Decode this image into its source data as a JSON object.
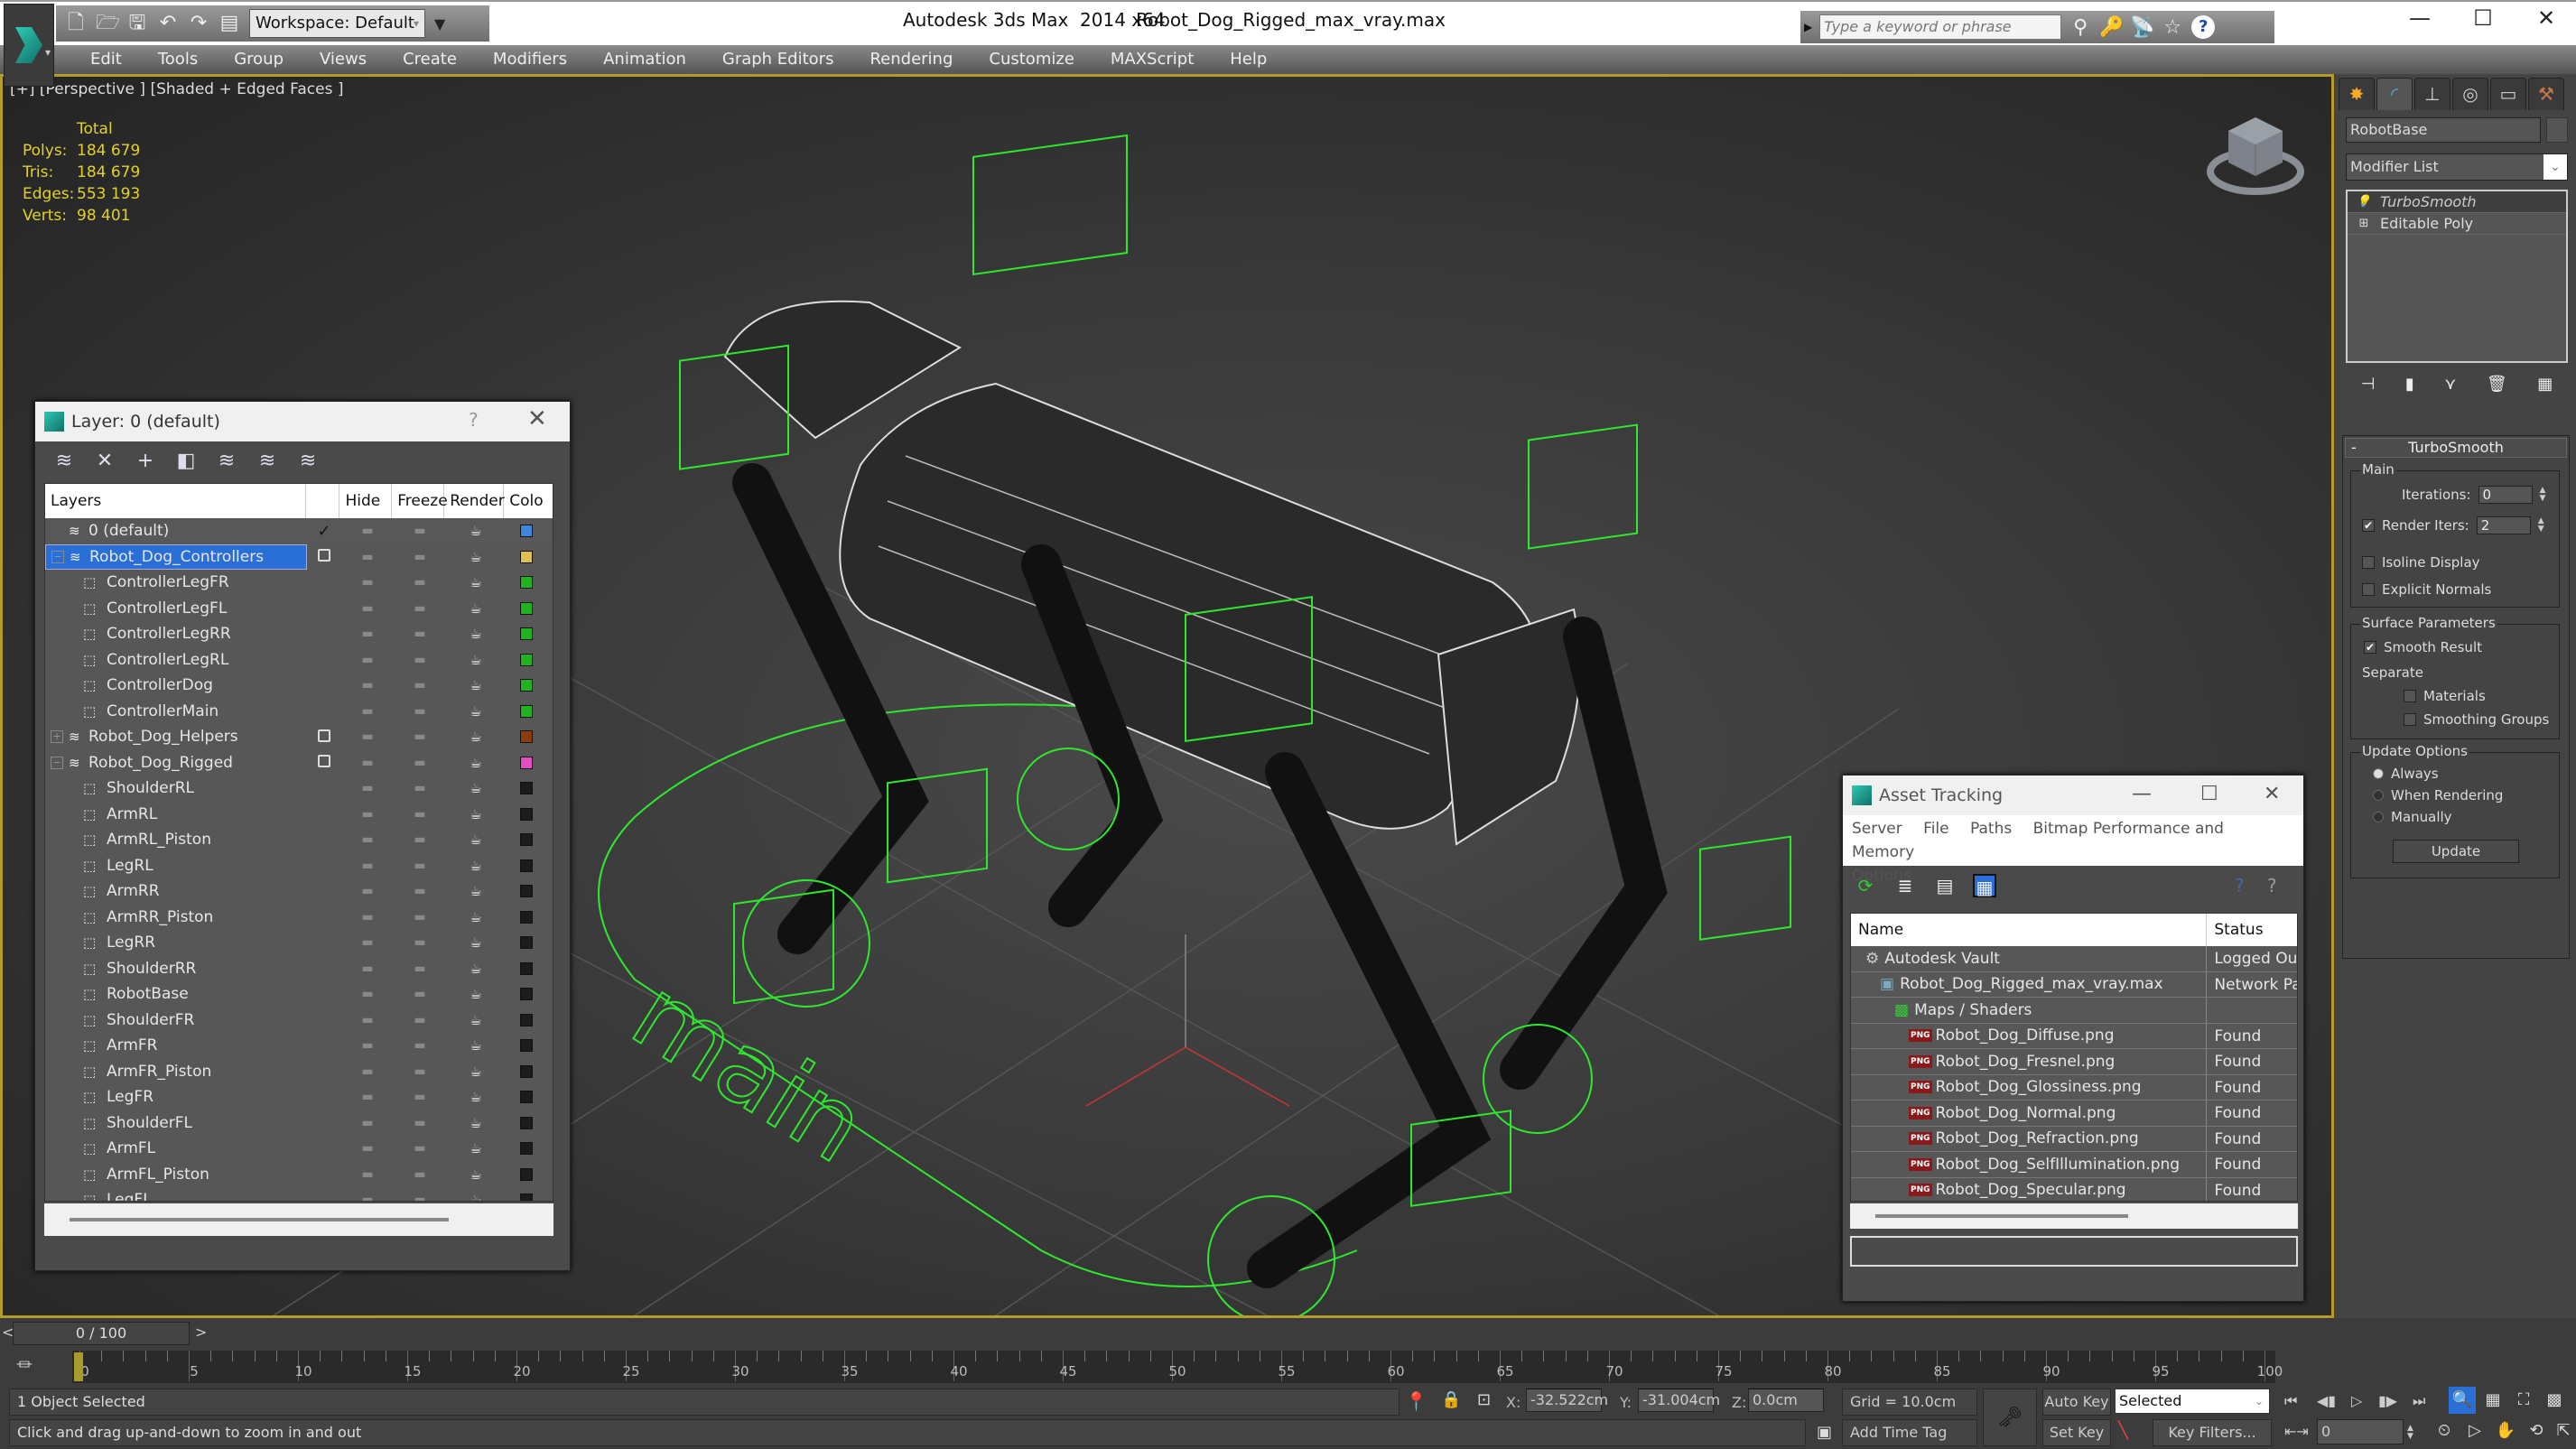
{
  "window": {
    "app_title": "Autodesk 3ds Max  2014 x64",
    "file_title": "Robot_Dog_Rigged_max_vray.max",
    "workspace": "Workspace: Default",
    "search_placeholder": "Type a keyword or phrase",
    "controls": {
      "minimize": "—",
      "maximize": "☐",
      "close": "✕"
    }
  },
  "menu": [
    "Edit",
    "Tools",
    "Group",
    "Views",
    "Create",
    "Modifiers",
    "Animation",
    "Graph Editors",
    "Rendering",
    "Customize",
    "MAXScript",
    "Help"
  ],
  "viewport": {
    "label": "[+] [Perspective ] [Shaded + Edged Faces ]",
    "stats": {
      "header": "Total",
      "rows": [
        {
          "key": "Polys:",
          "value": "184 679"
        },
        {
          "key": "Tris:",
          "value": "184 679"
        },
        {
          "key": "Edges:",
          "value": "553 193"
        },
        {
          "key": "Verts:",
          "value": "98 401"
        }
      ]
    },
    "ground_text": "main",
    "accent_color": "#b59a2c",
    "wire_color": "#2ee82e"
  },
  "layer_dialog": {
    "title": "Layer: 0 (default)",
    "help": "?",
    "close": "✕",
    "columns": [
      "Layers",
      "",
      "Hide",
      "Freeze",
      "Render",
      "Colo"
    ],
    "rows": [
      {
        "name": "0 (default)",
        "type": "layer",
        "expand": "",
        "current": "check",
        "color": "#3f86e0"
      },
      {
        "name": "Robot_Dog_Controllers",
        "type": "layer",
        "expand": "−",
        "current": "box",
        "color": "#e0c050",
        "selected": true
      },
      {
        "name": "ControllerLegFR",
        "type": "object",
        "color": "#1fb41f"
      },
      {
        "name": "ControllerLegFL",
        "type": "object",
        "color": "#1fb41f"
      },
      {
        "name": "ControllerLegRR",
        "type": "object",
        "color": "#1fb41f"
      },
      {
        "name": "ControllerLegRL",
        "type": "object",
        "color": "#1fb41f"
      },
      {
        "name": "ControllerDog",
        "type": "object",
        "color": "#1fb41f"
      },
      {
        "name": "ControllerMain",
        "type": "object",
        "color": "#1fb41f"
      },
      {
        "name": "Robot_Dog_Helpers",
        "type": "layer",
        "expand": "+",
        "current": "box",
        "color": "#8a3e0c"
      },
      {
        "name": "Robot_Dog_Rigged",
        "type": "layer",
        "expand": "−",
        "current": "box",
        "color": "#e050c0"
      },
      {
        "name": "ShoulderRL",
        "type": "object",
        "color": "#1c1c1c"
      },
      {
        "name": "ArmRL",
        "type": "object",
        "color": "#1c1c1c"
      },
      {
        "name": "ArmRL_Piston",
        "type": "object",
        "color": "#1c1c1c"
      },
      {
        "name": "LegRL",
        "type": "object",
        "color": "#1c1c1c"
      },
      {
        "name": "ArmRR",
        "type": "object",
        "color": "#1c1c1c"
      },
      {
        "name": "ArmRR_Piston",
        "type": "object",
        "color": "#1c1c1c"
      },
      {
        "name": "LegRR",
        "type": "object",
        "color": "#1c1c1c"
      },
      {
        "name": "ShoulderRR",
        "type": "object",
        "color": "#1c1c1c"
      },
      {
        "name": "RobotBase",
        "type": "object",
        "color": "#1c1c1c"
      },
      {
        "name": "ShoulderFR",
        "type": "object",
        "color": "#1c1c1c"
      },
      {
        "name": "ArmFR",
        "type": "object",
        "color": "#1c1c1c"
      },
      {
        "name": "ArmFR_Piston",
        "type": "object",
        "color": "#1c1c1c"
      },
      {
        "name": "LegFR",
        "type": "object",
        "color": "#1c1c1c"
      },
      {
        "name": "ShoulderFL",
        "type": "object",
        "color": "#1c1c1c"
      },
      {
        "name": "ArmFL",
        "type": "object",
        "color": "#1c1c1c"
      },
      {
        "name": "ArmFL_Piston",
        "type": "object",
        "color": "#1c1c1c"
      },
      {
        "name": "LegFL",
        "type": "object",
        "color": "#1c1c1c"
      }
    ]
  },
  "command_panel": {
    "tabs": [
      "create",
      "modify",
      "hierarchy",
      "motion",
      "display",
      "utilities"
    ],
    "object_name": "RobotBase",
    "modifier_list": "Modifier List",
    "stack": [
      "TurboSmooth",
      "Editable Poly"
    ],
    "turbosmooth": {
      "title": "TurboSmooth",
      "main_label": "Main",
      "iterations_label": "Iterations:",
      "iterations": "0",
      "render_iters_label": "Render Iters:",
      "render_iters": "2",
      "render_iters_checked": true,
      "isoline_display": "Isoline Display",
      "isoline_checked": false,
      "explicit_normals": "Explicit Normals",
      "explicit_checked": false,
      "surface_label": "Surface Parameters",
      "smooth_result": "Smooth Result",
      "smooth_checked": true,
      "separate_label": "Separate",
      "materials": "Materials",
      "materials_checked": false,
      "smoothing_groups": "Smoothing Groups",
      "smoothing_checked": false,
      "update_label": "Update Options",
      "update_options": [
        "Always",
        "When Rendering",
        "Manually"
      ],
      "update_selected": "Always",
      "update_button": "Update"
    }
  },
  "asset_tracking": {
    "title": "Asset Tracking",
    "menu": [
      "Server",
      "File",
      "Paths",
      "Bitmap Performance and Memory",
      "Options"
    ],
    "columns": [
      "Name",
      "Status"
    ],
    "rows": [
      {
        "name": "Autodesk Vault",
        "status": "Logged Out",
        "indent": 1,
        "icon": "vault"
      },
      {
        "name": "Robot_Dog_Rigged_max_vray.max",
        "status": "Network Pa",
        "indent": 2,
        "icon": "max"
      },
      {
        "name": "Maps / Shaders",
        "status": "",
        "indent": 3,
        "icon": "maps"
      },
      {
        "name": "Robot_Dog_Diffuse.png",
        "status": "Found",
        "indent": 4,
        "icon": "png"
      },
      {
        "name": "Robot_Dog_Fresnel.png",
        "status": "Found",
        "indent": 4,
        "icon": "png"
      },
      {
        "name": "Robot_Dog_Glossiness.png",
        "status": "Found",
        "indent": 4,
        "icon": "png"
      },
      {
        "name": "Robot_Dog_Normal.png",
        "status": "Found",
        "indent": 4,
        "icon": "png"
      },
      {
        "name": "Robot_Dog_Refraction.png",
        "status": "Found",
        "indent": 4,
        "icon": "png"
      },
      {
        "name": "Robot_Dog_SelfIllumination.png",
        "status": "Found",
        "indent": 4,
        "icon": "png"
      },
      {
        "name": "Robot_Dog_Specular.png",
        "status": "Found",
        "indent": 4,
        "icon": "png"
      }
    ]
  },
  "timeline": {
    "slider_label": "0 / 100",
    "current_frame": 0,
    "start": 0,
    "end": 100,
    "tick_labels": [
      "0",
      "5",
      "10",
      "15",
      "20",
      "25",
      "30",
      "35",
      "40",
      "45",
      "50",
      "55",
      "60",
      "65",
      "70",
      "75",
      "80",
      "85",
      "90",
      "95",
      "100"
    ]
  },
  "status": {
    "selection": "1 Object Selected",
    "prompt": "Click and drag up-and-down to zoom in and out",
    "x_label": "X:",
    "x": "-32.522cm",
    "y_label": "Y:",
    "y": "-31.004cm",
    "z_label": "Z:",
    "z": "0.0cm",
    "grid": "Grid = 10.0cm",
    "add_time_tag": "Add Time Tag",
    "auto_key": "Auto Key",
    "set_key": "Set Key",
    "key_mode": "Selected",
    "key_filters": "Key Filters...",
    "frame": "0"
  }
}
